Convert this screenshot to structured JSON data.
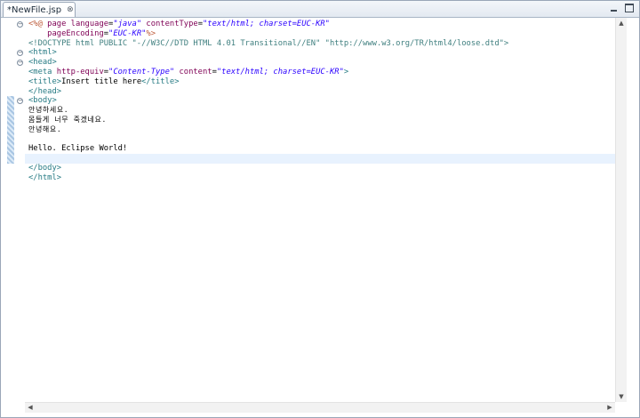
{
  "tab": {
    "label": "*NewFile.jsp",
    "close_glyph": "⊗"
  },
  "editor": {
    "lines": [
      {
        "parts": [
          {
            "t": "<%@",
            "c": "jsp"
          },
          {
            "t": " page ",
            "c": "attr"
          },
          {
            "t": "language",
            "c": "attr"
          },
          {
            "t": "=",
            "c": ""
          },
          {
            "t": "\"java\"",
            "c": "str"
          },
          {
            "t": " contentType",
            "c": "attr"
          },
          {
            "t": "=",
            "c": ""
          },
          {
            "t": "\"text/html; charset=EUC-KR\"",
            "c": "str"
          }
        ]
      },
      {
        "parts": [
          {
            "t": "    pageEncoding",
            "c": "attr"
          },
          {
            "t": "=",
            "c": ""
          },
          {
            "t": "\"EUC-KR\"",
            "c": "str"
          },
          {
            "t": "%>",
            "c": "jsp"
          }
        ]
      },
      {
        "parts": [
          {
            "t": "<!DOCTYPE html PUBLIC \"-//W3C//DTD HTML 4.01 Transitional//EN\" \"http://www.w3.org/TR/html4/loose.dtd\">",
            "c": "doctype"
          }
        ]
      },
      {
        "parts": [
          {
            "t": "<html>",
            "c": "tag"
          }
        ]
      },
      {
        "parts": [
          {
            "t": "<head>",
            "c": "tag"
          }
        ]
      },
      {
        "parts": [
          {
            "t": "<meta",
            "c": "tag"
          },
          {
            "t": " http-equiv",
            "c": "attr"
          },
          {
            "t": "=",
            "c": ""
          },
          {
            "t": "\"Content-Type\"",
            "c": "str"
          },
          {
            "t": " content",
            "c": "attr"
          },
          {
            "t": "=",
            "c": ""
          },
          {
            "t": "\"text/html; charset=EUC-KR\"",
            "c": "str"
          },
          {
            "t": ">",
            "c": "tag"
          }
        ]
      },
      {
        "parts": [
          {
            "t": "<title>",
            "c": "tag"
          },
          {
            "t": "Insert title here",
            "c": ""
          },
          {
            "t": "</title>",
            "c": "tag"
          }
        ]
      },
      {
        "parts": [
          {
            "t": "</head>",
            "c": "tag"
          }
        ]
      },
      {
        "parts": [
          {
            "t": "<body>",
            "c": "tag"
          }
        ]
      },
      {
        "parts": [
          {
            "t": "안녕하세요.",
            "c": "kor"
          }
        ]
      },
      {
        "parts": [
          {
            "t": "몸들게 너무 죽겠네요.",
            "c": "kor"
          }
        ]
      },
      {
        "parts": [
          {
            "t": "안녕해요.",
            "c": "kor"
          }
        ]
      },
      {
        "parts": [
          {
            "t": "",
            "c": ""
          }
        ]
      },
      {
        "parts": [
          {
            "t": "Hello. Eclipse World!",
            "c": ""
          }
        ]
      },
      {
        "parts": [
          {
            "t": "",
            "c": ""
          }
        ]
      },
      {
        "parts": [
          {
            "t": "</body>",
            "c": "tag"
          }
        ]
      },
      {
        "parts": [
          {
            "t": "</html>",
            "c": "tag"
          }
        ]
      }
    ],
    "fold_markers": [
      {
        "line": 1,
        "glyph": "−"
      },
      {
        "line": 4,
        "glyph": "−"
      },
      {
        "line": 5,
        "glyph": "−"
      },
      {
        "line": 9,
        "glyph": "−"
      }
    ]
  },
  "scrollbars": {
    "up_glyph": "▲",
    "down_glyph": "▼",
    "left_glyph": "◀",
    "right_glyph": "▶"
  },
  "colors": {
    "tag": "#277b84",
    "attribute": "#7f0055",
    "string": "#2a00ff",
    "jsp_delimiter": "#bf5f3f",
    "current_line": "#e8f2fe"
  }
}
